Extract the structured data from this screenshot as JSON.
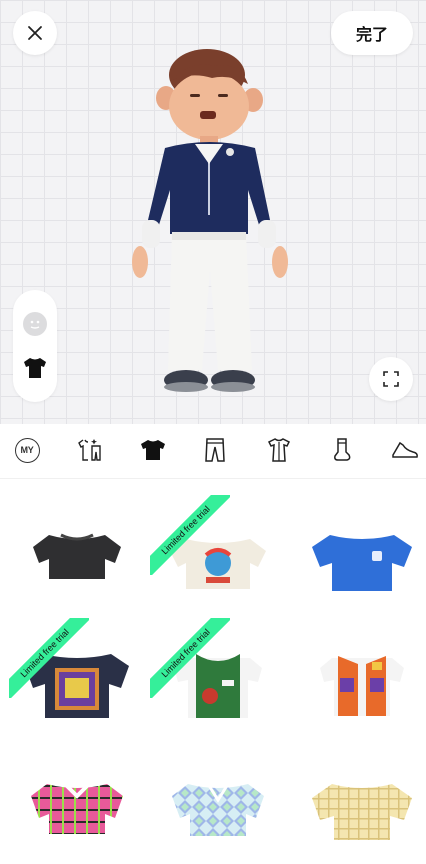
{
  "header": {
    "done_label": "完了"
  },
  "tabs": [
    {
      "id": "my",
      "label": "MY"
    },
    {
      "id": "sets",
      "icon": "outfit-set-icon"
    },
    {
      "id": "tops",
      "icon": "tshirt-icon",
      "selected": true
    },
    {
      "id": "bottoms",
      "icon": "pants-icon"
    },
    {
      "id": "onepiece",
      "icon": "dress-icon"
    },
    {
      "id": "socks",
      "icon": "sock-icon"
    },
    {
      "id": "shoes",
      "icon": "sneaker-icon"
    }
  ],
  "items": [
    {
      "name": "black cropped t-shirt",
      "badge": ""
    },
    {
      "name": "cream graphic cropped tee",
      "badge": "Limited free trial"
    },
    {
      "name": "blue t-shirt",
      "badge": ""
    },
    {
      "name": "navy poster print tee",
      "badge": "Limited free trial"
    },
    {
      "name": "green basketball jersey",
      "badge": "Limited free trial"
    },
    {
      "name": "orange patch vest",
      "badge": ""
    },
    {
      "name": "pink plaid shirt",
      "badge": ""
    },
    {
      "name": "mint argyle cardigan",
      "badge": ""
    },
    {
      "name": "yellow check shirt",
      "badge": ""
    }
  ],
  "colors": {
    "badge": "#35ef9a",
    "stage_bg": "#f3f3f5",
    "accent": "#111111"
  }
}
